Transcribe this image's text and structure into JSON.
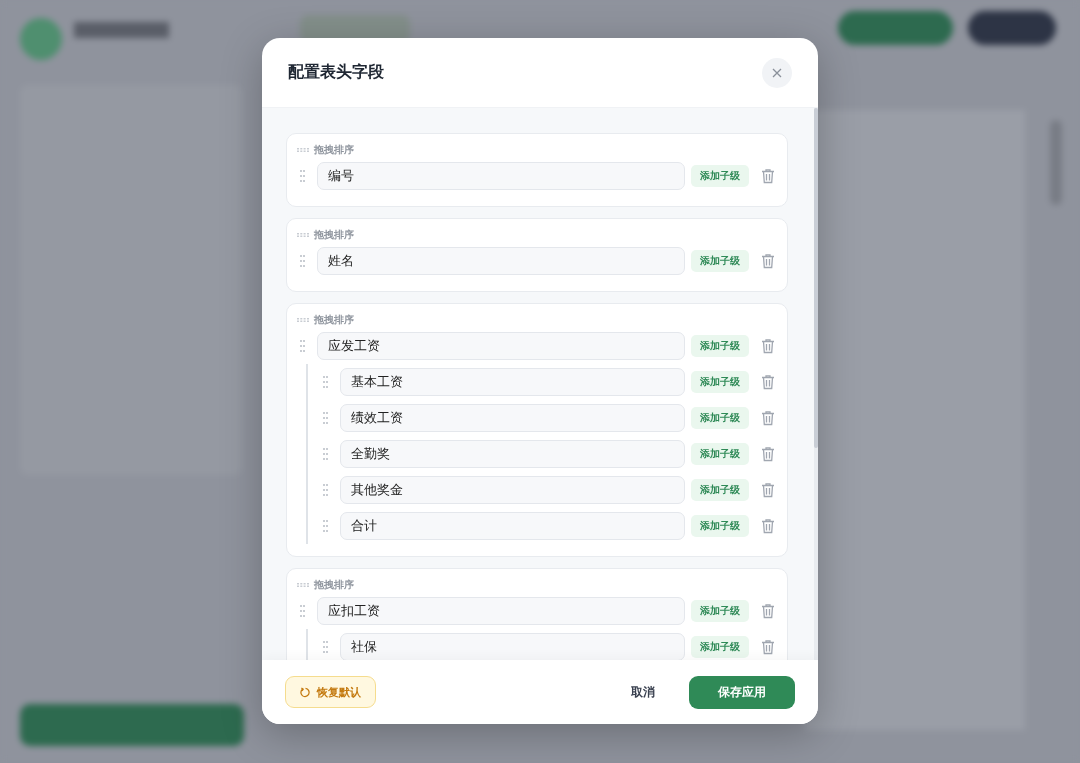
{
  "dialog": {
    "title": "配置表头字段",
    "fields": [
      {
        "drag_hint": "拖拽排序",
        "value": "编号",
        "add_button": "添加子级"
      },
      {
        "drag_hint": "拖拽排序",
        "value": "姓名",
        "add_button": "添加子级"
      },
      {
        "drag_hint": "拖拽排序",
        "value": "应发工资",
        "add_button": "添加子级",
        "children": [
          {
            "value": "基本工资",
            "add_button": "添加子级"
          },
          {
            "value": "绩效工资",
            "add_button": "添加子级"
          },
          {
            "value": "全勤奖",
            "add_button": "添加子级"
          },
          {
            "value": "其他奖金",
            "add_button": "添加子级"
          },
          {
            "value": "合计",
            "add_button": "添加子级"
          }
        ]
      },
      {
        "drag_hint": "拖拽排序",
        "value": "应扣工资",
        "add_button": "添加子级",
        "children": [
          {
            "value": "社保",
            "add_button": "添加子级"
          }
        ]
      }
    ],
    "footer": {
      "reset_button": "恢复默认",
      "cancel_button": "取消",
      "save_button": "保存应用"
    }
  }
}
